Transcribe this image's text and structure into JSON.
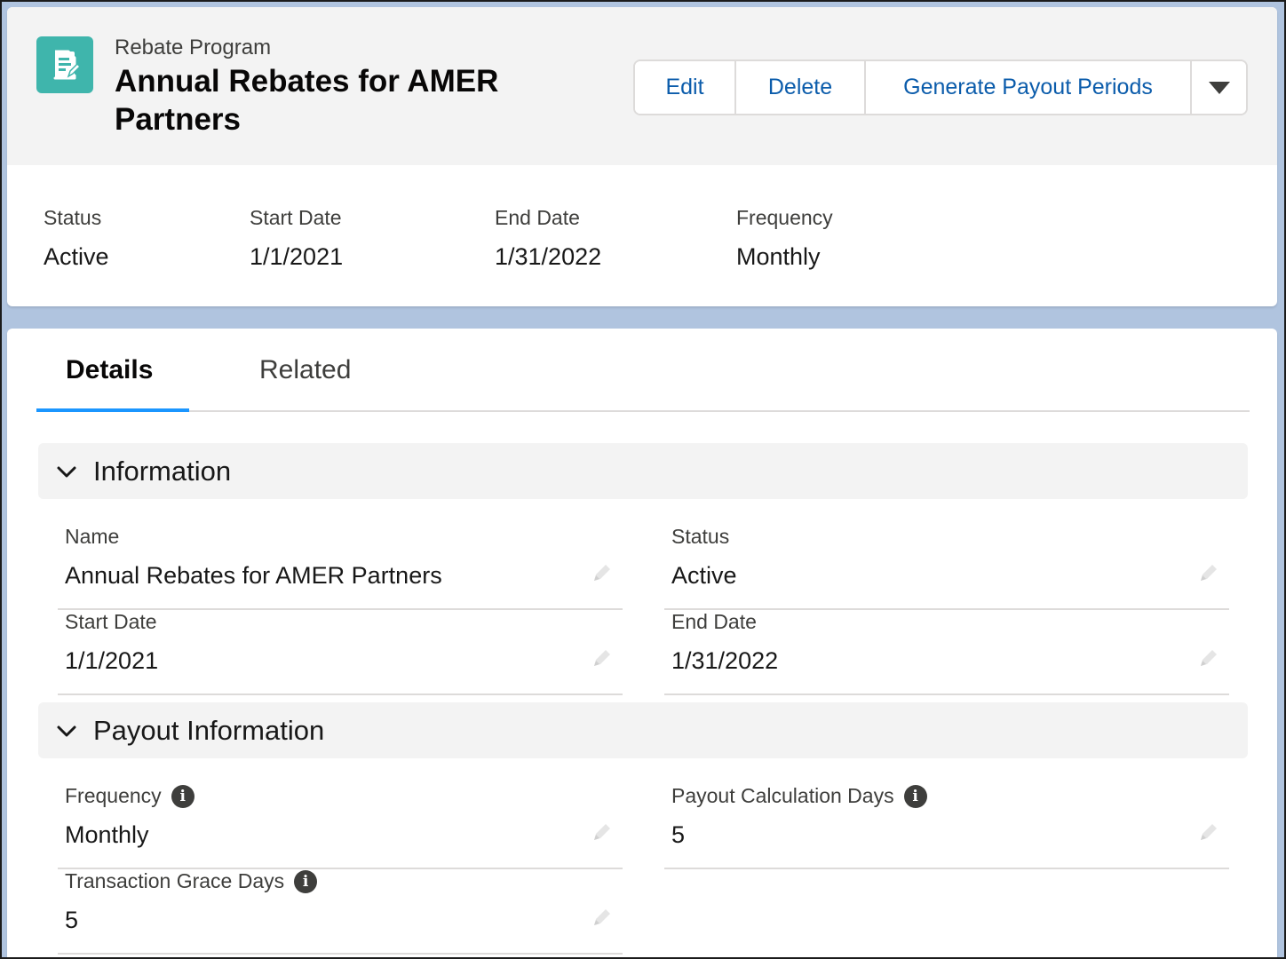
{
  "header": {
    "object_label": "Rebate Program",
    "title": "Annual Rebates for AMER Partners",
    "actions": {
      "edit": "Edit",
      "delete": "Delete",
      "generate": "Generate Payout Periods"
    },
    "icon": "rebate-program-icon"
  },
  "highlights": [
    {
      "label": "Status",
      "value": "Active"
    },
    {
      "label": "Start Date",
      "value": "1/1/2021"
    },
    {
      "label": "End Date",
      "value": "1/31/2022"
    },
    {
      "label": "Frequency",
      "value": "Monthly"
    }
  ],
  "tabs": [
    {
      "label": "Details"
    },
    {
      "label": "Related"
    }
  ],
  "sections": {
    "information": {
      "title": "Information",
      "fields": {
        "name": {
          "label": "Name",
          "value": "Annual Rebates for AMER Partners"
        },
        "status": {
          "label": "Status",
          "value": "Active"
        },
        "start_date": {
          "label": "Start Date",
          "value": "1/1/2021"
        },
        "end_date": {
          "label": "End Date",
          "value": "1/31/2022"
        }
      }
    },
    "payout": {
      "title": "Payout Information",
      "fields": {
        "frequency": {
          "label": "Frequency",
          "value": "Monthly"
        },
        "calc_days": {
          "label": "Payout Calculation Days",
          "value": "5"
        },
        "grace_days": {
          "label": "Transaction Grace Days",
          "value": "5"
        }
      }
    }
  },
  "colors": {
    "accent": "#0b5cab",
    "icon_bg": "#3fb5ac",
    "tab_underline": "#1b96ff",
    "background": "#b0c4df"
  }
}
